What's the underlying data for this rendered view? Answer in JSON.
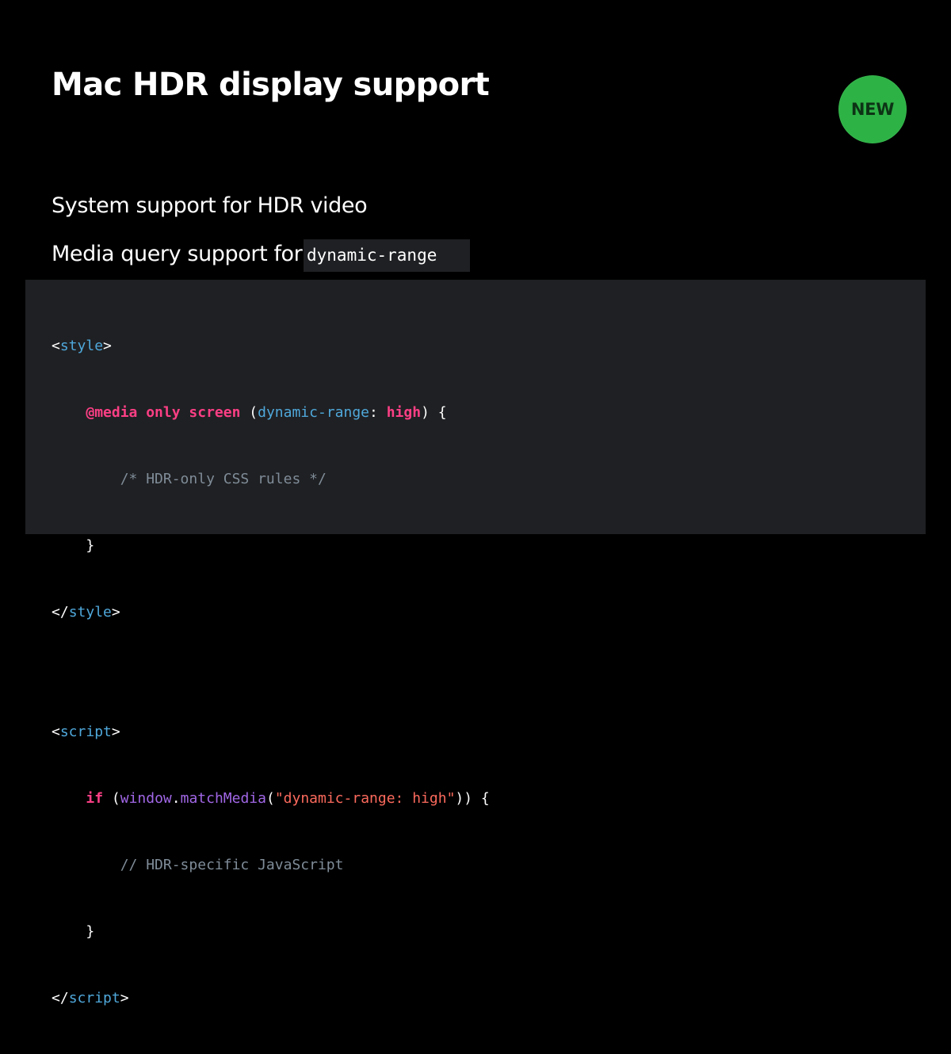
{
  "slide": {
    "title": "Mac HDR display support",
    "badge": "NEW",
    "bullets": [
      "System support for HDR video",
      "Media query support for"
    ],
    "inline_code": "dynamic-range"
  },
  "code": {
    "style_open_lt": "<",
    "style_tag": "style",
    "style_open_gt": ">",
    "media_kw": "@media only screen",
    "media_paren_open": " (",
    "media_feature": "dynamic-range",
    "media_colon": ": ",
    "media_value": "high",
    "media_paren_close": ") {",
    "css_comment": "/* HDR-only CSS rules */",
    "close_brace": "}",
    "style_close_lt": "</",
    "style_close_tag": "style",
    "style_close_gt": ">",
    "script_open_lt": "<",
    "script_tag": "script",
    "script_open_gt": ">",
    "if_kw": "if",
    "if_paren_open": " (",
    "window_obj": "window",
    "dot": ".",
    "match_media": "matchMedia",
    "call_open": "(",
    "query_string": "\"dynamic-range: high\"",
    "call_close": ")) {",
    "js_comment": "// HDR-specific JavaScript",
    "script_close_lt": "</",
    "script_close_tag": "script",
    "script_close_gt": ">"
  },
  "colors": {
    "background": "#000000",
    "code_background": "#1f2023",
    "badge_green": "#2db245",
    "tag_blue": "#4fa8db",
    "keyword_pink": "#fc3f85",
    "comment_gray": "#7f8c98",
    "function_purple": "#a167e6",
    "string_red": "#fc6a5d"
  }
}
